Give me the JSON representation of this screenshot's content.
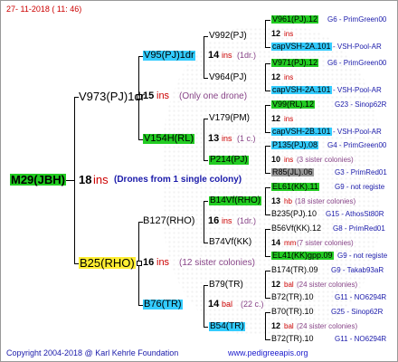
{
  "header": {
    "timestamp": "27- 11-2018 ( 11: 46)"
  },
  "footer": {
    "copyright": "Copyright 2004-2018 @ Karl Kehrle Foundation",
    "site": "www.pedigreeapis.org"
  },
  "colors": {
    "green": "#22cc22",
    "cyan": "#33ccff",
    "yellow": "#ffee33",
    "gray": "#999999",
    "red": "#cc0000",
    "blue": "#1a1acc"
  },
  "root": {
    "id": "M29(JBH)",
    "ins_num": "18",
    "ins_word": "ins",
    "note": "(Drones from 1 single colony)"
  },
  "g1": {
    "upper": {
      "id": "V973(PJ)1dr",
      "num": "15",
      "ins": "ins",
      "note": "(Only one drone)"
    },
    "lower": {
      "id": "B25(RHO)",
      "num": "16",
      "ins": "ins",
      "note": "(12 sister colonies)"
    }
  },
  "g2": {
    "a": {
      "id": "V95(PJ)1dr",
      "num": "14",
      "ins": "ins",
      "note": "(1dr.)"
    },
    "b": {
      "id": "V154H(RL)",
      "num": "13",
      "ins": "ins",
      "note": "(1 c.)"
    },
    "c": {
      "id": "B127(RHO)",
      "num": "16",
      "ins": "ins",
      "note": "(1dr.)"
    },
    "d": {
      "id": "B76(TR)",
      "num": "14",
      "ins": "bal",
      "note": "(22 c.)"
    }
  },
  "g3": {
    "a1": "V992(PJ)",
    "a2": "V964(PJ)",
    "b1": "V179(PM)",
    "b2": "P214(PJ)",
    "c1": "B14Vf(RHO)",
    "c2": "B74Vf(KK)",
    "d1": "B79(TR)",
    "d2": "B54(TR)"
  },
  "g4": [
    {
      "id": "V961(PJ).12",
      "info": "G6 - PrimGreen00"
    },
    {
      "num": "12",
      "ins": "ins"
    },
    {
      "id": "capVSH-2A.101",
      "info": "- VSH-Pool-AR"
    },
    {
      "id": "V971(PJ).12",
      "info": "G6 - PrimGreen00"
    },
    {
      "num": "12",
      "ins": "ins"
    },
    {
      "id": "capVSH-2A.101",
      "info": "- VSH-Pool-AR"
    },
    {
      "id": "V99(RL).12",
      "info": "G23 - Sinop62R"
    },
    {
      "num": "12",
      "ins": "ins"
    },
    {
      "id": "capVSH-2B.101",
      "info": "- VSH-Pool-AR"
    },
    {
      "id": "P135(PJ).08",
      "info": "G4 - PrimGreen00"
    },
    {
      "num": "10",
      "ins": "ins",
      "note": "(3 sister colonies)"
    },
    {
      "id": "R85(JL).06",
      "info": "G3 - PrimRed01"
    },
    {
      "id": "EL61(KK).11",
      "info": "G9 - not registe"
    },
    {
      "num": "13",
      "ins": "hb",
      "note": "(18 sister colonies)"
    },
    {
      "id": "B235(PJ).10",
      "info": "G15 - AthosSt80R"
    },
    {
      "id": "B56Vf(KK).12",
      "info": "G8 - PrimRed01"
    },
    {
      "num": "14",
      "ins": "mm",
      "note": "(7 sister colonies)"
    },
    {
      "id": "EL41(KK)gpp.09",
      "info": "G9 - not registe"
    },
    {
      "id": "B174(TR).09",
      "info": "G9 - Takab93aR"
    },
    {
      "num": "12",
      "ins": "bal",
      "note": "(24 sister colonies)"
    },
    {
      "id": "B72(TR).10",
      "info": "G11 - NO6294R"
    },
    {
      "id": "B70(TR).10",
      "info": "G25 - Sinop62R"
    },
    {
      "num": "12",
      "ins": "bal",
      "note": "(24 sister colonies)"
    },
    {
      "id": "B72(TR).10",
      "info": "G11 - NO6294R"
    }
  ]
}
